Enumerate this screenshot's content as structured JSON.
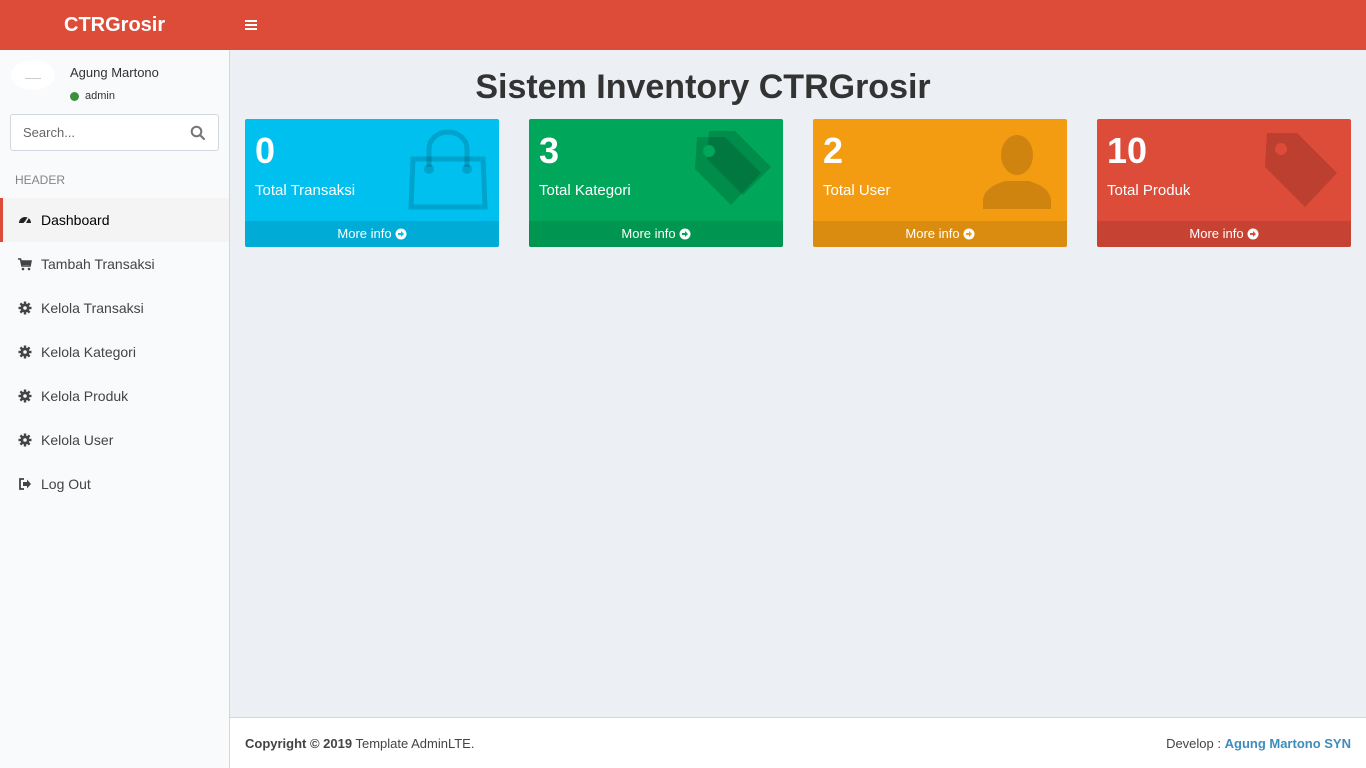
{
  "header": {
    "app_title": "CTRGrosir",
    "menu_icon": "hamburger-icon",
    "color": "#dd4b39"
  },
  "sidebar": {
    "user": {
      "name": "Agung Martono",
      "status": "admin",
      "status_color": "#3d8f3d"
    },
    "search": {
      "placeholder": "Search...",
      "value": "",
      "icon": "search-icon"
    },
    "section_header": "HEADER",
    "items": [
      {
        "label": "Dashboard",
        "icon": "dashboard-icon",
        "active": true
      },
      {
        "label": "Tambah Transaksi",
        "icon": "cart-icon",
        "active": false
      },
      {
        "label": "Kelola Transaksi",
        "icon": "gear-icon",
        "active": false
      },
      {
        "label": "Kelola Kategori",
        "icon": "gear-icon",
        "active": false
      },
      {
        "label": "Kelola Produk",
        "icon": "gear-icon",
        "active": false
      },
      {
        "label": "Kelola User",
        "icon": "gear-icon",
        "active": false
      },
      {
        "label": "Log Out",
        "icon": "sign-out-icon",
        "active": false
      }
    ]
  },
  "main": {
    "title": "Sistem Inventory CTRGrosir",
    "boxes": [
      {
        "value": "0",
        "label": "Total Transaksi",
        "link": "More info",
        "icon": "shopping-bag-icon",
        "color": "#00c0ef"
      },
      {
        "value": "3",
        "label": "Total Kategori",
        "link": "More info",
        "icon": "tags-icon",
        "color": "#00a65a"
      },
      {
        "value": "2",
        "label": "Total User",
        "link": "More info",
        "icon": "user-icon",
        "color": "#f39c12"
      },
      {
        "value": "10",
        "label": "Total Produk",
        "link": "More info",
        "icon": "tag-icon",
        "color": "#dd4b39"
      }
    ]
  },
  "footer": {
    "copyright_bold": "Copyright © 2019",
    "copyright_text": " Template AdminLTE.",
    "develop_label": "Develop : ",
    "developer": "Agung Martono SYN",
    "link_color": "#3c8dbc"
  }
}
